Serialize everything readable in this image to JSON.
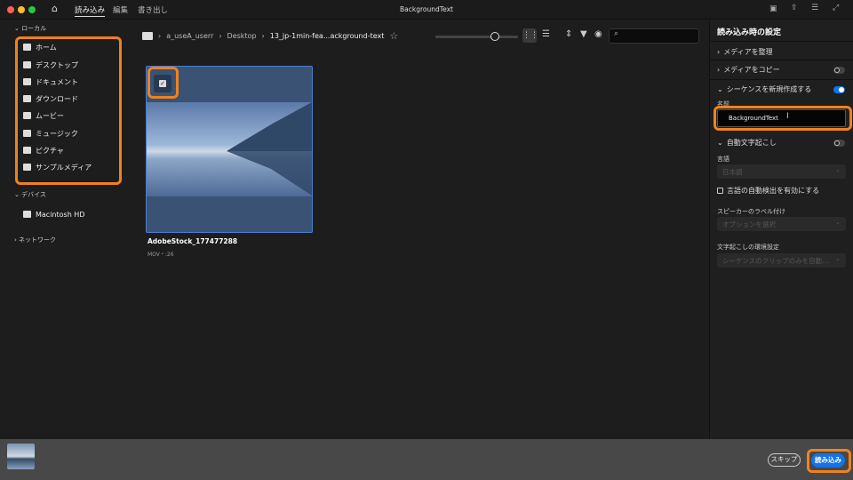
{
  "window": {
    "title": "BackgroundText"
  },
  "tabs": [
    {
      "label": "読み込み",
      "active": true
    },
    {
      "label": "編集"
    },
    {
      "label": "書き出し"
    }
  ],
  "breadcrumb": [
    "a_useA_userr",
    "Desktop",
    "13_jp-1min-fea...ackground-text"
  ],
  "sidebar": {
    "local_label": "ローカル",
    "items": [
      {
        "label": "ホーム",
        "icon": "home-icon"
      },
      {
        "label": "デスクトップ",
        "icon": "desktop-icon"
      },
      {
        "label": "ドキュメント",
        "icon": "document-icon"
      },
      {
        "label": "ダウンロード",
        "icon": "download-icon"
      },
      {
        "label": "ムービー",
        "icon": "movie-icon"
      },
      {
        "label": "ミュージック",
        "icon": "music-icon"
      },
      {
        "label": "ピクチャ",
        "icon": "picture-icon"
      },
      {
        "label": "サンプルメディア",
        "icon": "folder-icon"
      }
    ],
    "devices_label": "デバイス",
    "devices": [
      {
        "label": "Macintosh HD",
        "icon": "folder-icon"
      }
    ],
    "network_label": "ネットワーク"
  },
  "media": [
    {
      "name": "AdobeStock_177477288",
      "meta": "MOV・:26",
      "selected": true
    }
  ],
  "panel": {
    "title": "読み込み時の設定",
    "organize": "メディアを整理",
    "copy": "メディアをコピー",
    "copy_on": false,
    "new_sequence": "シーケンスを新規作成する",
    "new_sequence_on": true,
    "name_label": "名前",
    "name_value": "BackgroundText",
    "transcribe": "自動文字起こし",
    "transcribe_on": false,
    "language_label": "言語",
    "language_value": "日本語",
    "auto_detect": "言語の自動検出を有効にする",
    "speaker_label": "スピーカーのラベル付け",
    "speaker_value": "オプションを選択",
    "pref_label": "文字起こしの環境設定",
    "pref_value": "シーケンスのクリップのみを自動…"
  },
  "footer": {
    "skip": "スキップ",
    "import": "読み込み"
  },
  "colors": {
    "accent": "#1473e6",
    "highlight": "#f0821e",
    "selection": "#3a5273"
  }
}
